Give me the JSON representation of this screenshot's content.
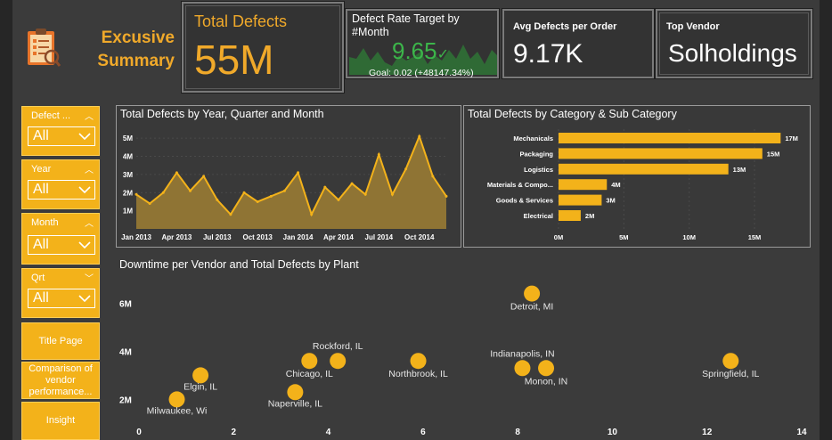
{
  "title": {
    "line1": "Excusive",
    "line2": "Summary"
  },
  "kpis": {
    "total_defects": {
      "label": "Total Defects",
      "value": "55M"
    },
    "defect_rate": {
      "label": "Defect Rate Target by #Month",
      "value": "9.65",
      "goal": "Goal: 0.02 (+48147.34%)"
    },
    "avg_defects": {
      "label": "Avg Defects per Order",
      "value": "9.17K"
    },
    "top_vendor": {
      "label": "Top Vendor",
      "value": "Solholdings"
    }
  },
  "slicers": [
    {
      "label": "Defect ...",
      "value": "All"
    },
    {
      "label": "Year",
      "value": "All"
    },
    {
      "label": "Month",
      "value": "All"
    },
    {
      "label": "Qrt",
      "value": "All"
    }
  ],
  "nav": {
    "title_page": "Title Page",
    "comparison": "Comparison of vendor performance...",
    "insight": "Insight"
  },
  "colors": {
    "accent": "#f3b21a",
    "positive": "#3cb54a",
    "bg": "#3b3b3b"
  },
  "chart_data": [
    {
      "type": "area",
      "title": "Total Defects by Year, Quarter and Month",
      "xlabel": "",
      "ylabel": "",
      "ylim": [
        0,
        5.4
      ],
      "ytick_labels": [
        "1M",
        "2M",
        "3M",
        "4M",
        "5M"
      ],
      "yticks": [
        1,
        2,
        3,
        4,
        5
      ],
      "xtick_labels": [
        "Jan 2013",
        "Apr 2013",
        "Jul 2013",
        "Oct 2013",
        "Jan 2014",
        "Apr 2014",
        "Jul 2014",
        "Oct 2014"
      ],
      "xtick_index": [
        0,
        3,
        6,
        9,
        12,
        15,
        18,
        21
      ],
      "x": [
        0,
        1,
        2,
        3,
        4,
        5,
        6,
        7,
        8,
        9,
        10,
        11,
        12,
        13,
        14,
        15,
        16,
        17,
        18,
        19,
        20,
        21,
        22,
        23
      ],
      "values": [
        1.9,
        1.4,
        2.0,
        3.1,
        2.1,
        2.9,
        1.6,
        0.8,
        2.0,
        1.5,
        1.8,
        2.1,
        3.1,
        0.8,
        2.3,
        1.6,
        2.5,
        1.9,
        4.1,
        1.9,
        3.3,
        5.1,
        2.9,
        1.8
      ],
      "color": "#f3b21a"
    },
    {
      "type": "bar",
      "title": "Total Defects by Category & Sub Category",
      "categories": [
        "Mechanicals",
        "Packaging",
        "Logistics",
        "Materials & Compo...",
        "Goods & Services",
        "Electrical"
      ],
      "values": [
        17,
        15.6,
        13,
        3.7,
        3.3,
        1.7
      ],
      "data_labels": [
        "17M",
        "15M",
        "13M",
        "4M",
        "3M",
        "2M"
      ],
      "xlim": [
        0,
        18
      ],
      "xticks": [
        0,
        5,
        10,
        15
      ],
      "xtick_labels": [
        "0M",
        "5M",
        "10M",
        "15M"
      ],
      "color": "#f3b21a"
    },
    {
      "type": "scatter",
      "title": "Downtime per Vendor and Total Defects by Plant",
      "xlim": [
        0,
        14
      ],
      "xticks": [
        0,
        2,
        4,
        6,
        8,
        10,
        12,
        14
      ],
      "ylim": [
        1.2,
        7.2
      ],
      "yticks": [
        2,
        4,
        6
      ],
      "ytick_labels": [
        "2M",
        "4M",
        "6M"
      ],
      "points": [
        {
          "label": "Milwaukee, Wi",
          "x": 0.8,
          "y": 2.0
        },
        {
          "label": "Elgin, IL",
          "x": 1.3,
          "y": 3.0
        },
        {
          "label": "Naperville, IL",
          "x": 3.3,
          "y": 2.3
        },
        {
          "label": "Chicago, IL",
          "x": 3.6,
          "y": 3.6
        },
        {
          "label": "Rockford, IL",
          "x": 4.2,
          "y": 3.6
        },
        {
          "label": "Northbrook, IL",
          "x": 5.9,
          "y": 3.6
        },
        {
          "label": "Indianapolis, IN",
          "x": 8.1,
          "y": 3.3
        },
        {
          "label": "Monon, IN",
          "x": 8.6,
          "y": 3.3
        },
        {
          "label": "Detroit, MI",
          "x": 8.3,
          "y": 6.4
        },
        {
          "label": "Springfield, IL",
          "x": 12.5,
          "y": 3.6
        }
      ],
      "color": "#f3b21a"
    }
  ]
}
